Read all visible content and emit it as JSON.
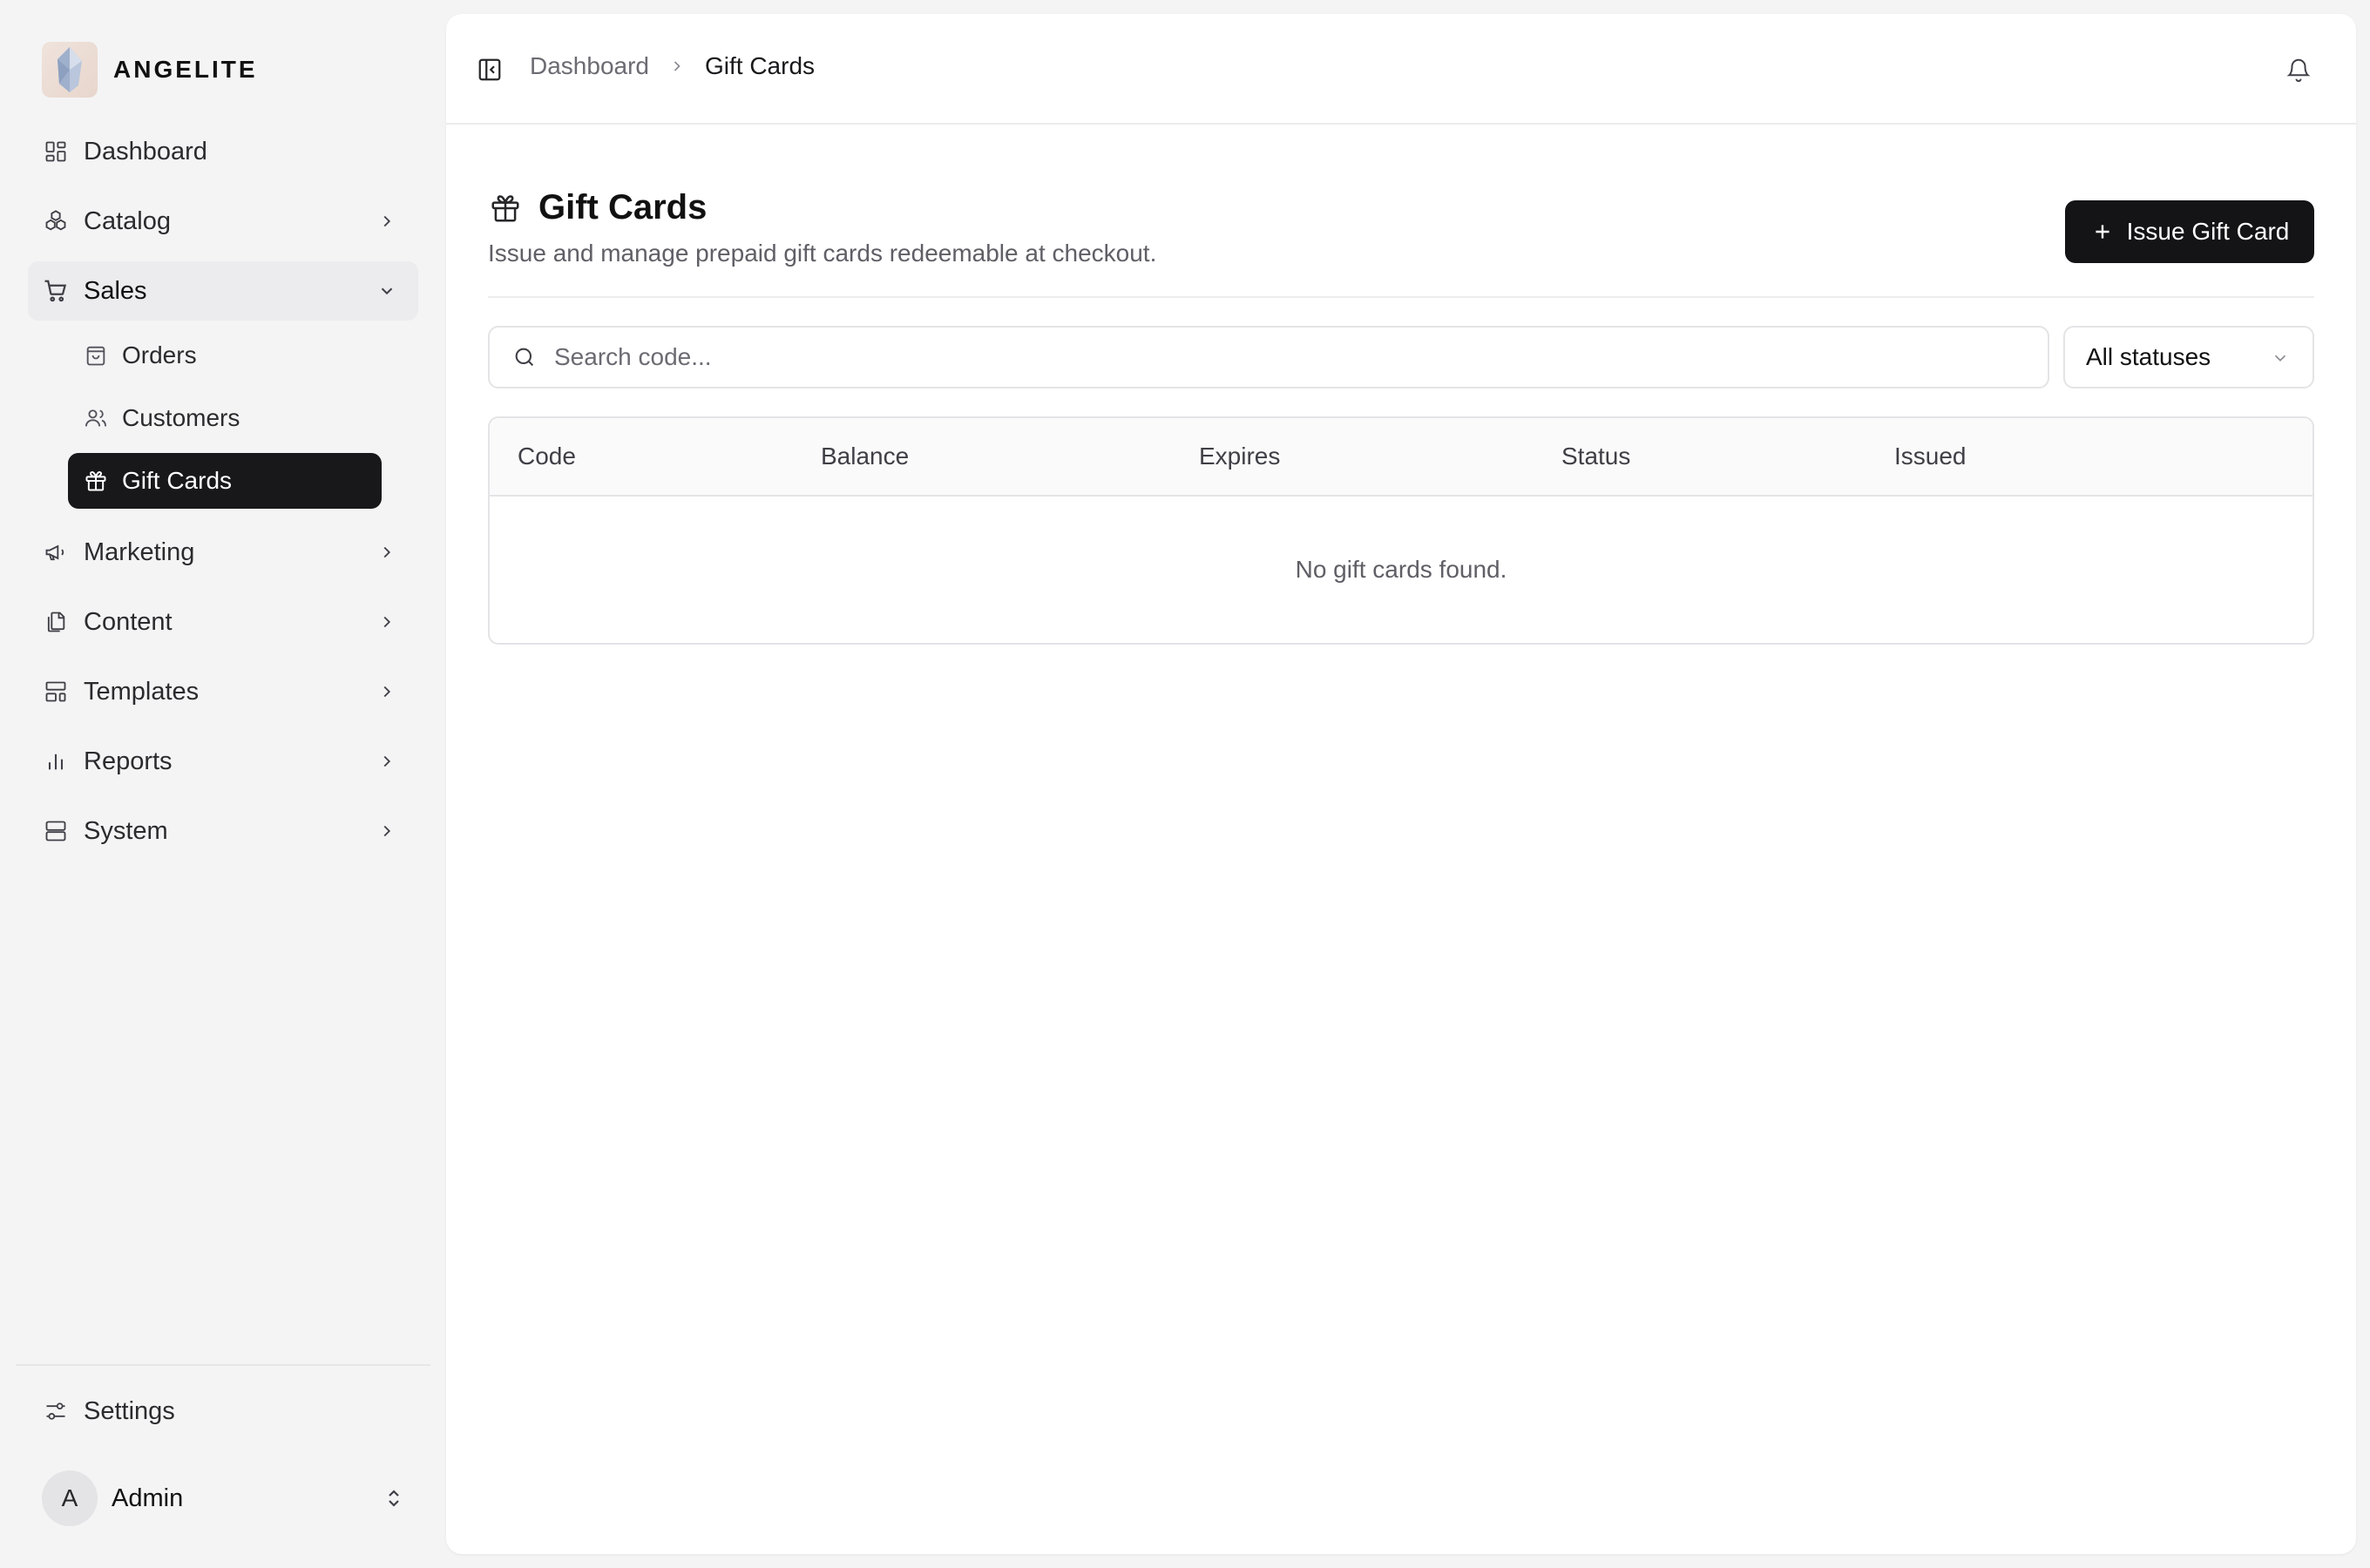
{
  "brand": {
    "name": "ANGELITE"
  },
  "sidebar": {
    "items": [
      {
        "label": "Dashboard",
        "icon": "layout-dashboard-icon"
      },
      {
        "label": "Catalog",
        "icon": "cubes-icon"
      },
      {
        "label": "Sales",
        "icon": "shopping-cart-icon"
      },
      {
        "label": "Marketing",
        "icon": "megaphone-icon"
      },
      {
        "label": "Content",
        "icon": "files-icon"
      },
      {
        "label": "Templates",
        "icon": "layout-template-icon"
      },
      {
        "label": "Reports",
        "icon": "bar-chart-icon"
      },
      {
        "label": "System",
        "icon": "server-icon"
      }
    ],
    "sales_children": [
      {
        "label": "Orders",
        "icon": "shopping-bag-icon"
      },
      {
        "label": "Customers",
        "icon": "users-icon"
      },
      {
        "label": "Gift Cards",
        "icon": "gift-icon"
      }
    ],
    "settings_label": "Settings",
    "user": {
      "initial": "A",
      "name": "Admin"
    }
  },
  "topbar": {
    "breadcrumb": {
      "parent": "Dashboard",
      "current": "Gift Cards"
    }
  },
  "page": {
    "title": "Gift Cards",
    "subtitle": "Issue and manage prepaid gift cards redeemable at checkout.",
    "issue_button_label": "Issue Gift Card"
  },
  "filters": {
    "search_placeholder": "Search code...",
    "status_selected": "All statuses"
  },
  "table": {
    "columns": [
      "Code",
      "Balance",
      "Expires",
      "Status",
      "Issued"
    ],
    "empty_message": "No gift cards found."
  },
  "colors": {
    "accent": "#18181b",
    "sidebar_bg": "#f4f4f5",
    "panel_bg": "#ffffff",
    "border": "#e4e4e7"
  }
}
